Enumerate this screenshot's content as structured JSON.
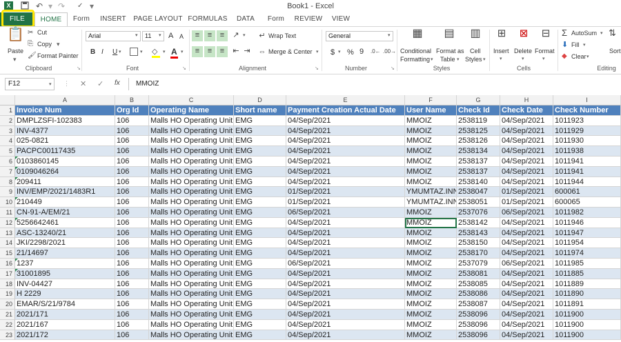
{
  "window": {
    "title": "Book1 - Excel"
  },
  "quick_access": {
    "excel_icon": "X",
    "save_icon": "save-icon",
    "undo_icon": "↶",
    "redo_icon": "↷",
    "spell_icon": "✓"
  },
  "tabs": [
    "FILE",
    "HOME",
    "Form",
    "INSERT",
    "PAGE LAYOUT",
    "FORMULAS",
    "DATA",
    "Form",
    "REVIEW",
    "VIEW"
  ],
  "ribbon": {
    "clipboard": {
      "paste": "Paste",
      "cut": "Cut",
      "copy": "Copy",
      "copy_arrow": "▾",
      "format_painter": "Format Painter",
      "label": "Clipboard"
    },
    "font": {
      "name": "Arial",
      "size": "11",
      "grow": "A",
      "shrink": "A",
      "bold": "B",
      "italic": "I",
      "underline": "U",
      "font_color": "A",
      "label": "Font"
    },
    "alignment": {
      "wrap": "Wrap Text",
      "merge": "Merge & Center",
      "label": "Alignment"
    },
    "number": {
      "format": "General",
      "currency": "$",
      "percent": "%",
      "comma": "9",
      "label": "Number"
    },
    "styles": {
      "conditional": "Conditional",
      "conditional2": "Formatting",
      "format_as": "Format as",
      "table": "Table",
      "cell": "Cell",
      "cell_styles": "Styles",
      "label": "Styles"
    },
    "cells": {
      "insert": "Insert",
      "delete": "Delete",
      "format": "Format",
      "label": "Cells"
    },
    "editing": {
      "autosum": "AutoSum",
      "fill": "Fill",
      "clear": "Clear",
      "sort": "Sort",
      "label": "Editing"
    }
  },
  "formula_bar": {
    "name_box": "F12",
    "cancel": "✕",
    "enter": "✓",
    "fx": "fx",
    "value": "MMOIZ"
  },
  "columns": [
    "A",
    "B",
    "C",
    "D",
    "E",
    "F",
    "G",
    "H",
    "I"
  ],
  "header_row": [
    "Invoice Num",
    "Org Id",
    "Operating Name",
    "Short name",
    "Payment Creation Actual Date",
    "User Name",
    "Check Id",
    "Check Date",
    "Check Number"
  ],
  "rows": [
    [
      "DMPLZSFI-102383",
      "106",
      "Malls HO Operating Unit",
      "EMG",
      "04/Sep/2021",
      "MMOIZ",
      "2538119",
      "04/Sep/2021",
      "1011923"
    ],
    [
      "INV-4377",
      "106",
      "Malls HO Operating Unit",
      "EMG",
      "04/Sep/2021",
      "MMOIZ",
      "2538125",
      "04/Sep/2021",
      "1011929"
    ],
    [
      "025-0821",
      "106",
      "Malls HO Operating Unit",
      "EMG",
      "04/Sep/2021",
      "MMOIZ",
      "2538126",
      "04/Sep/2021",
      "1011930"
    ],
    [
      "PACPC00117435",
      "106",
      "Malls HO Operating Unit",
      "EMG",
      "04/Sep/2021",
      "MMOIZ",
      "2538134",
      "04/Sep/2021",
      "1011938"
    ],
    [
      "0103860145",
      "106",
      "Malls HO Operating Unit",
      "EMG",
      "04/Sep/2021",
      "MMOIZ",
      "2538137",
      "04/Sep/2021",
      "1011941"
    ],
    [
      "0109046264",
      "106",
      "Malls HO Operating Unit",
      "EMG",
      "04/Sep/2021",
      "MMOIZ",
      "2538137",
      "04/Sep/2021",
      "1011941"
    ],
    [
      "209411",
      "106",
      "Malls HO Operating Unit",
      "EMG",
      "04/Sep/2021",
      "MMOIZ",
      "2538140",
      "04/Sep/2021",
      "1011944"
    ],
    [
      "INV/EMP/2021/1483R1",
      "106",
      "Malls HO Operating Unit",
      "EMG",
      "01/Sep/2021",
      "YMUMTAZ.INN",
      "2538047",
      "01/Sep/2021",
      "600061"
    ],
    [
      "210449",
      "106",
      "Malls HO Operating Unit",
      "EMG",
      "01/Sep/2021",
      "YMUMTAZ.INN",
      "2538051",
      "01/Sep/2021",
      "600065"
    ],
    [
      "CN-91-A/EM/21",
      "106",
      "Malls HO Operating Unit",
      "EMG",
      "06/Sep/2021",
      "MMOIZ",
      "2537076",
      "06/Sep/2021",
      "1011982"
    ],
    [
      "5256642461",
      "106",
      "Malls HO Operating Unit",
      "EMG",
      "04/Sep/2021",
      "MMOIZ",
      "2538142",
      "04/Sep/2021",
      "1011946"
    ],
    [
      "ASC-13240/21",
      "106",
      "Malls HO Operating Unit",
      "EMG",
      "04/Sep/2021",
      "MMOIZ",
      "2538143",
      "04/Sep/2021",
      "1011947"
    ],
    [
      "JKI/2298/2021",
      "106",
      "Malls HO Operating Unit",
      "EMG",
      "04/Sep/2021",
      "MMOIZ",
      "2538150",
      "04/Sep/2021",
      "1011954"
    ],
    [
      "21/14697",
      "106",
      "Malls HO Operating Unit",
      "EMG",
      "04/Sep/2021",
      "MMOIZ",
      "2538170",
      "04/Sep/2021",
      "1011974"
    ],
    [
      "1237",
      "106",
      "Malls HO Operating Unit",
      "EMG",
      "06/Sep/2021",
      "MMOIZ",
      "2537079",
      "06/Sep/2021",
      "1011985"
    ],
    [
      "31001895",
      "106",
      "Malls HO Operating Unit",
      "EMG",
      "04/Sep/2021",
      "MMOIZ",
      "2538081",
      "04/Sep/2021",
      "1011885"
    ],
    [
      "INV-04427",
      "106",
      "Malls HO Operating Unit",
      "EMG",
      "04/Sep/2021",
      "MMOIZ",
      "2538085",
      "04/Sep/2021",
      "1011889"
    ],
    [
      "H 2229",
      "106",
      "Malls HO Operating Unit",
      "EMG",
      "04/Sep/2021",
      "MMOIZ",
      "2538086",
      "04/Sep/2021",
      "1011890"
    ],
    [
      "EMAR/S/21/9784",
      "106",
      "Malls HO Operating Unit",
      "EMG",
      "04/Sep/2021",
      "MMOIZ",
      "2538087",
      "04/Sep/2021",
      "1011891"
    ],
    [
      "2021/171",
      "106",
      "Malls HO Operating Unit",
      "EMG",
      "04/Sep/2021",
      "MMOIZ",
      "2538096",
      "04/Sep/2021",
      "1011900"
    ],
    [
      "2021/167",
      "106",
      "Malls HO Operating Unit",
      "EMG",
      "04/Sep/2021",
      "MMOIZ",
      "2538096",
      "04/Sep/2021",
      "1011900"
    ],
    [
      "2021/172",
      "106",
      "Malls HO Operating Unit",
      "EMG",
      "04/Sep/2021",
      "MMOIZ",
      "2538096",
      "04/Sep/2021",
      "1011900"
    ]
  ],
  "colors": {
    "header_fill": "#4f81bd",
    "band_fill": "#dce6f1",
    "file_tab": "#217346",
    "highlight": "#ffe600"
  }
}
